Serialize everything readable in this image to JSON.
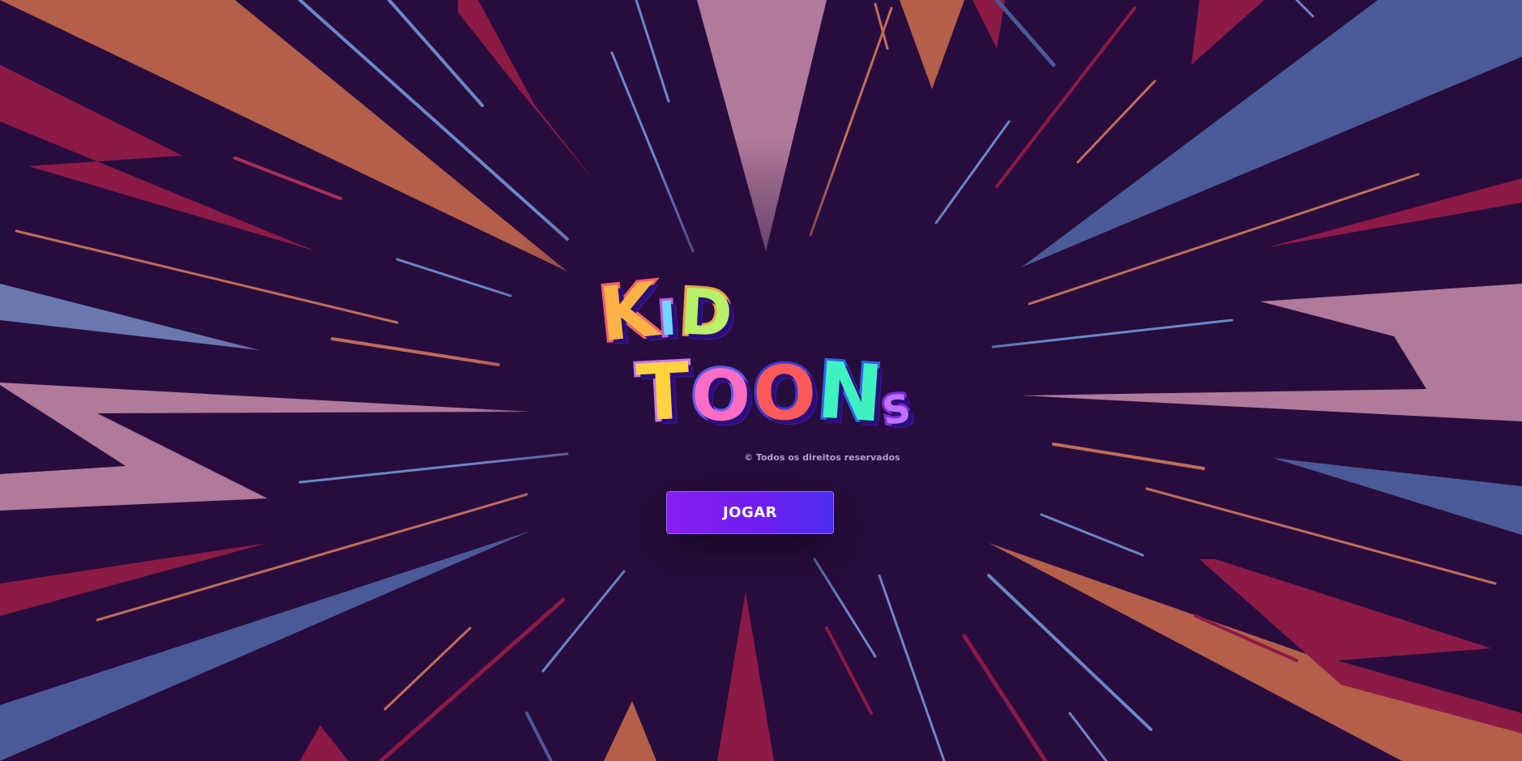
{
  "logo": {
    "line1": [
      "K",
      "I",
      "D"
    ],
    "line2": [
      "T",
      "O",
      "O",
      "N",
      "S"
    ]
  },
  "copyright": "© Todos os direitos reservados",
  "play_button": {
    "label": "JOGAR"
  },
  "colors": {
    "background": "#280c3e",
    "burst_orange": "#b45f4a",
    "burst_pink": "#b07a9a",
    "burst_blue": "#4a5a98",
    "burst_red": "#8c1a46",
    "button_start": "#8a1df0",
    "button_end": "#4b2cf0"
  }
}
